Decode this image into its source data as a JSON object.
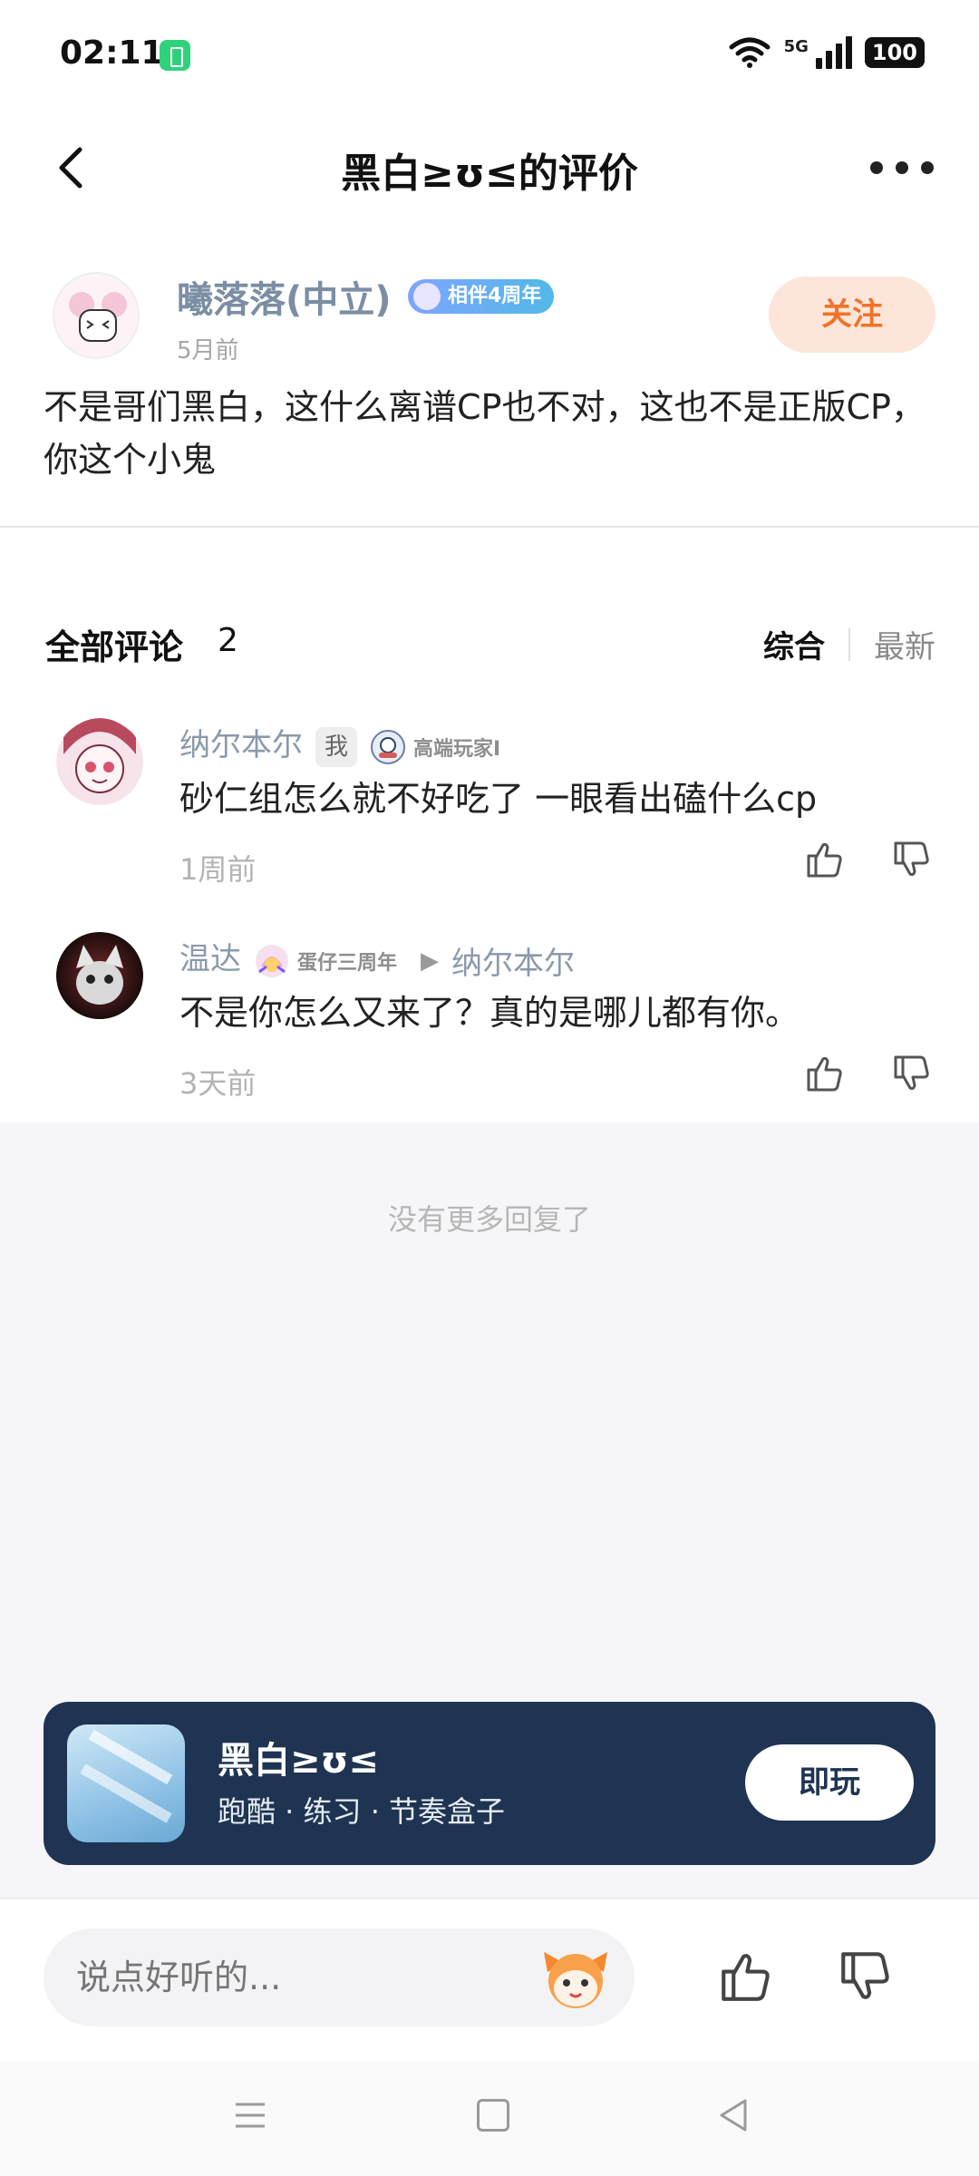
{
  "status_bar": {
    "time": "02:11",
    "network": "5G",
    "battery": "100"
  },
  "header": {
    "title": "黑白≥ʊ≤的评价"
  },
  "post": {
    "author_name": "曦落落(中立)",
    "author_badge": "相伴4周年",
    "time": "5月前",
    "follow_label": "关注",
    "body": "不是哥们黑白，这什么离谱CP也不对，这也不是正版CP，你这个小鬼"
  },
  "comments_section": {
    "title": "全部评论",
    "count": "2",
    "sort_options": [
      "综合",
      "最新"
    ],
    "active_sort": "综合",
    "no_more": "没有更多回复了"
  },
  "comments": [
    {
      "name": "纳尔本尔",
      "me_tag": "我",
      "badge": "高端玩家I",
      "text": "砂仁组怎么就不好吃了 一眼看出磕什么cp",
      "time": "1周前"
    },
    {
      "name": "温达",
      "badge": "蛋仔三周年",
      "reply_to": "纳尔本尔",
      "text": "不是你怎么又来了？真的是哪儿都有你。",
      "time": "3天前"
    }
  ],
  "game_card": {
    "name": "黑白≥ʊ≤",
    "tags": "跑酷 · 练习 · 节奏盒子",
    "play_label": "即玩"
  },
  "bottom_bar": {
    "input_placeholder": "说点好听的..."
  },
  "colors": {
    "accent_orange": "#f07329",
    "card_bg": "#1f3452",
    "name_blue": "#7b8ea3"
  }
}
